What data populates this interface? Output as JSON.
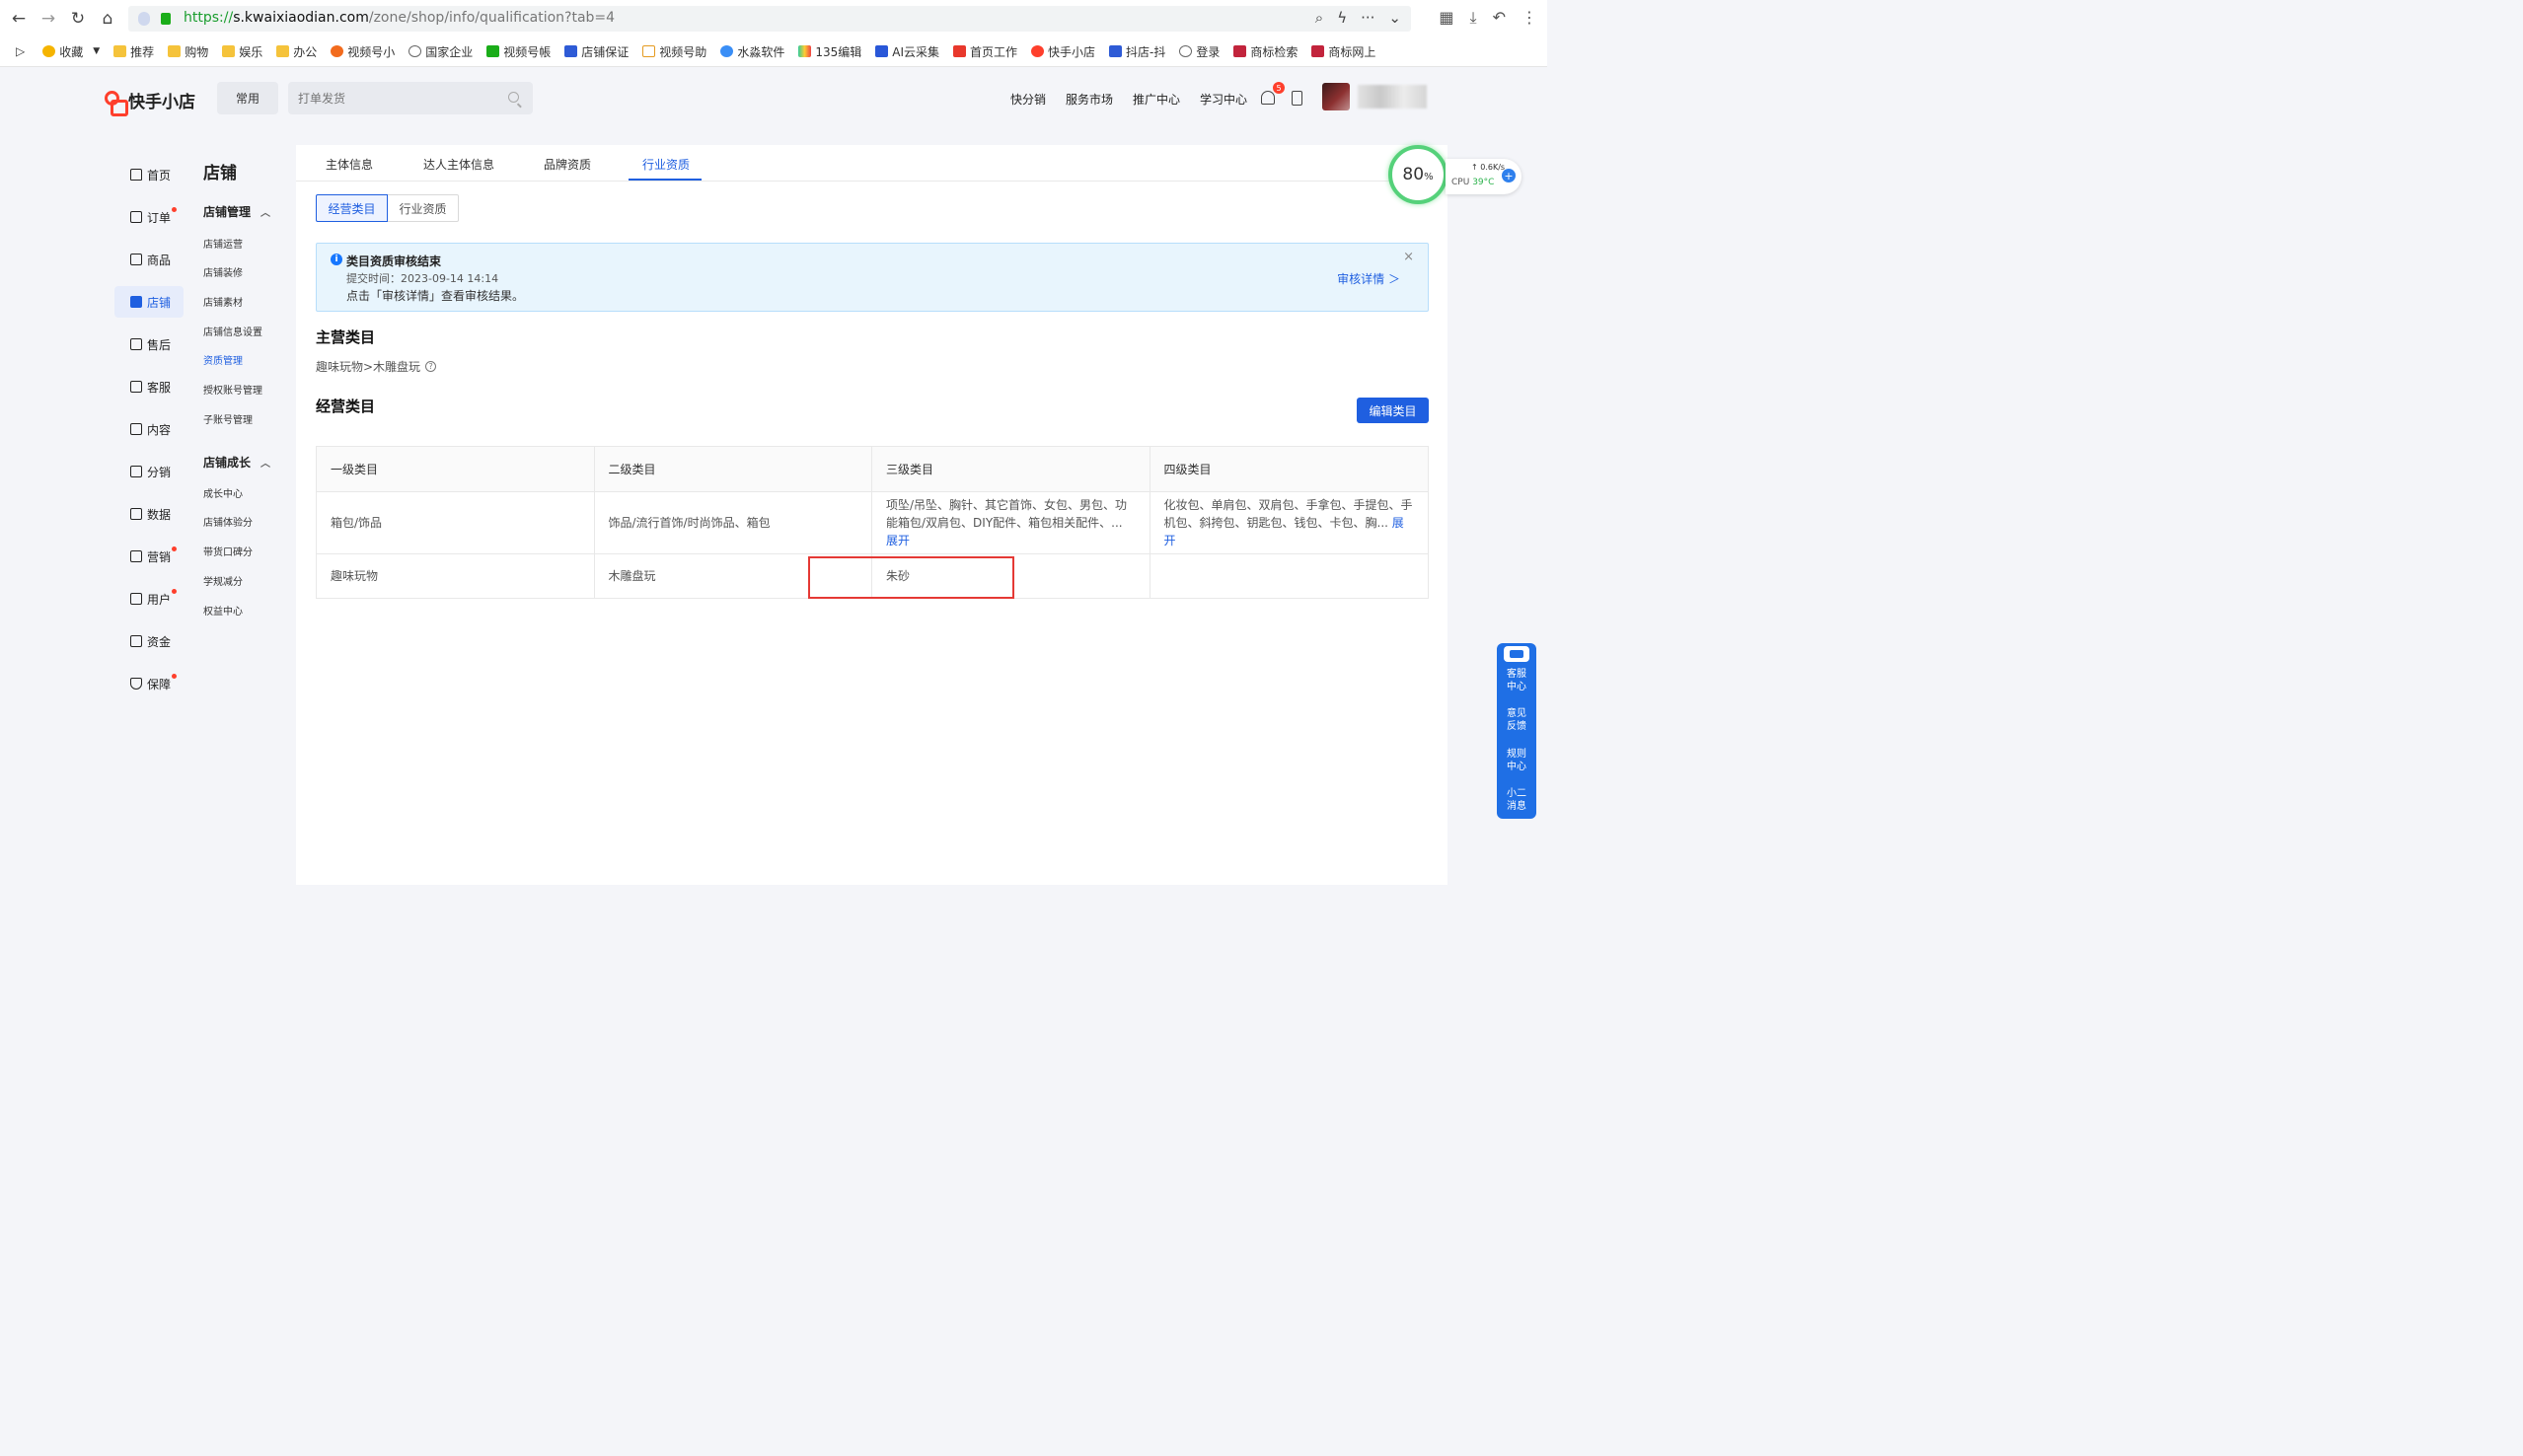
{
  "browser": {
    "url_proto": "https://",
    "url_host": "s.kwaixiaodian.com",
    "url_path": "/zone/shop/info/qualification?tab=4",
    "bookmarks": [
      "收藏",
      "推荐",
      "购物",
      "娱乐",
      "办公",
      "视频号小",
      "国家企业",
      "视频号帳",
      "店铺保证",
      "视频号助",
      "水淼软件",
      "135编辑",
      "AI云采集",
      "首页工作",
      "快手小店",
      "抖店-抖",
      "登录",
      "商标检索",
      "商标网上"
    ]
  },
  "header": {
    "logo_text": "快手小店",
    "common_label": "常用",
    "search_placeholder": "打单发货",
    "links": [
      "快分销",
      "服务市场",
      "推广中心",
      "学习中心"
    ],
    "notification_count": "5"
  },
  "sidebar": {
    "items": [
      {
        "label": "首页",
        "dot": false
      },
      {
        "label": "订单",
        "dot": true
      },
      {
        "label": "商品",
        "dot": false
      },
      {
        "label": "店铺",
        "dot": false,
        "active": true
      },
      {
        "label": "售后",
        "dot": false
      },
      {
        "label": "客服",
        "dot": false
      },
      {
        "label": "内容",
        "dot": false
      },
      {
        "label": "分销",
        "dot": false
      },
      {
        "label": "数据",
        "dot": false
      },
      {
        "label": "营销",
        "dot": true
      },
      {
        "label": "用户",
        "dot": true
      },
      {
        "label": "资金",
        "dot": false
      },
      {
        "label": "保障",
        "dot": true
      }
    ]
  },
  "submenu": {
    "title": "店铺",
    "group1": "店铺管理",
    "group1_items": [
      "店铺运营",
      "店铺装修",
      "店铺素材",
      "店铺信息设置",
      "资质管理",
      "授权账号管理",
      "子账号管理"
    ],
    "group2": "店铺成长",
    "group2_items": [
      "成长中心",
      "店铺体验分",
      "带货口碑分",
      "学规减分",
      "权益中心"
    ]
  },
  "tabs": [
    "主体信息",
    "达人主体信息",
    "品牌资质",
    "行业资质"
  ],
  "segments": [
    "经营类目",
    "行业资质"
  ],
  "notice": {
    "title": "类目资质审核结束",
    "time": "提交时间：2023-09-14 14:14",
    "tip": "点击「审核详情」查看审核结果。",
    "link": "审核详情 ＞",
    "close": "×"
  },
  "main_category": {
    "title": "主营类目",
    "value": "趣味玩物>木雕盘玩"
  },
  "business_category": {
    "title": "经营类目",
    "edit_button": "编辑类目",
    "headers": [
      "一级类目",
      "二级类目",
      "三级类目",
      "四级类目"
    ],
    "rows": [
      {
        "c1": "箱包/饰品",
        "c2": "饰品/流行首饰/时尚饰品、箱包",
        "c3": "项坠/吊坠、胸针、其它首饰、女包、男包、功能箱包/双肩包、DIY配件、箱包相关配件、...",
        "c4": "化妆包、单肩包、双肩包、手拿包、手提包、手机包、斜挎包、钥匙包、钱包、卡包、胸...",
        "expand": "展开"
      },
      {
        "c1": "趣味玩物",
        "c2": "木雕盘玩",
        "c3": "朱砂",
        "c4": ""
      }
    ]
  },
  "cpu_widget": {
    "percent": "80",
    "percent_unit": "%",
    "speed": "↑  0.6K/s",
    "cpu_label": "CPU",
    "temp": "39°C"
  },
  "float_bar": [
    "客服中心",
    "意见反馈",
    "规则中心",
    "小二消息"
  ],
  "colors": {
    "accent": "#1f5fe0",
    "brand": "#fe3f2c",
    "highlight": "#e53935"
  }
}
